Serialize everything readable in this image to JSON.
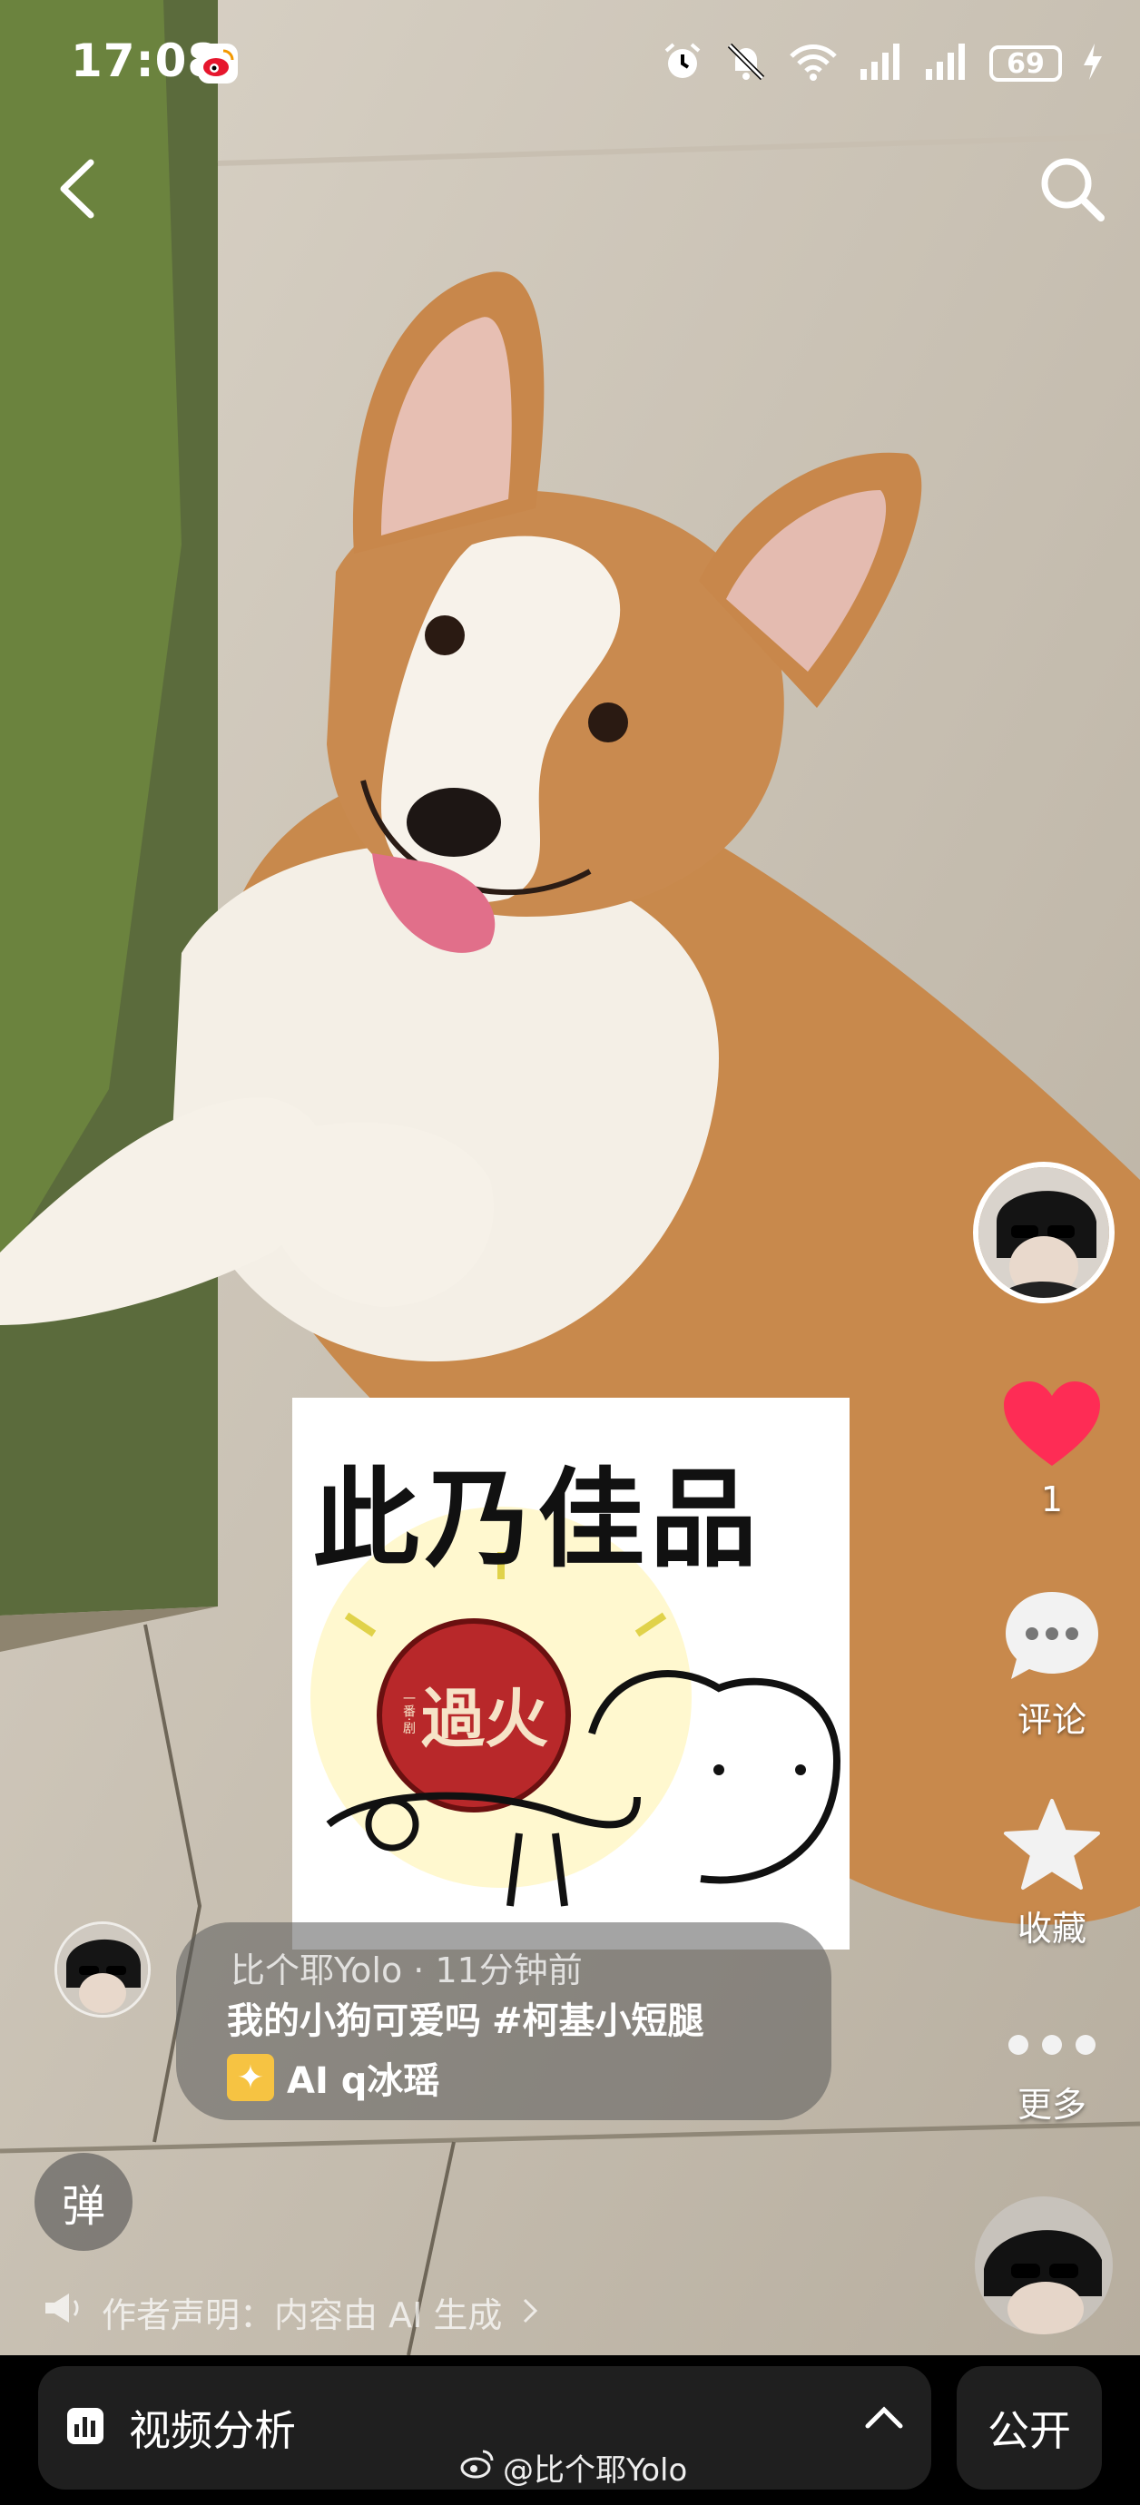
{
  "status_bar": {
    "time": "17:08",
    "battery": "69",
    "icons": [
      "weibo-icon",
      "alarm-icon",
      "mute-icon",
      "wifi-icon",
      "signal-icon",
      "signal-icon",
      "battery-icon",
      "charging-icon"
    ]
  },
  "header": {
    "back_icon": "chevron-left-icon",
    "search_icon": "search-icon"
  },
  "video": {
    "description": "corgi photo background",
    "sticker": {
      "text": "此乃佳品",
      "seal_text": "過火",
      "seal_small": "一番·剧"
    }
  },
  "right_rail": {
    "like_count": "1",
    "comment_label": "评论",
    "favorite_label": "收藏",
    "more_label": "更多"
  },
  "caption": {
    "meta": "比个耶Yolo · 11分钟前",
    "title": "我的小狗可爱吗",
    "tag": "#柯基小短腿",
    "ai_text": "AI q冰瑶"
  },
  "danmu": {
    "label": "弹"
  },
  "disclaimer": {
    "text": "作者声明：内容由 AI 生成"
  },
  "bottom_bar": {
    "analysis_label": "视频分析",
    "public_label": "公开"
  },
  "watermark": {
    "text": "@比个耶Yolo"
  },
  "colors": {
    "like": "#fe2c55",
    "panel": "#1f1f1f",
    "sparkle": "#f6c342"
  }
}
